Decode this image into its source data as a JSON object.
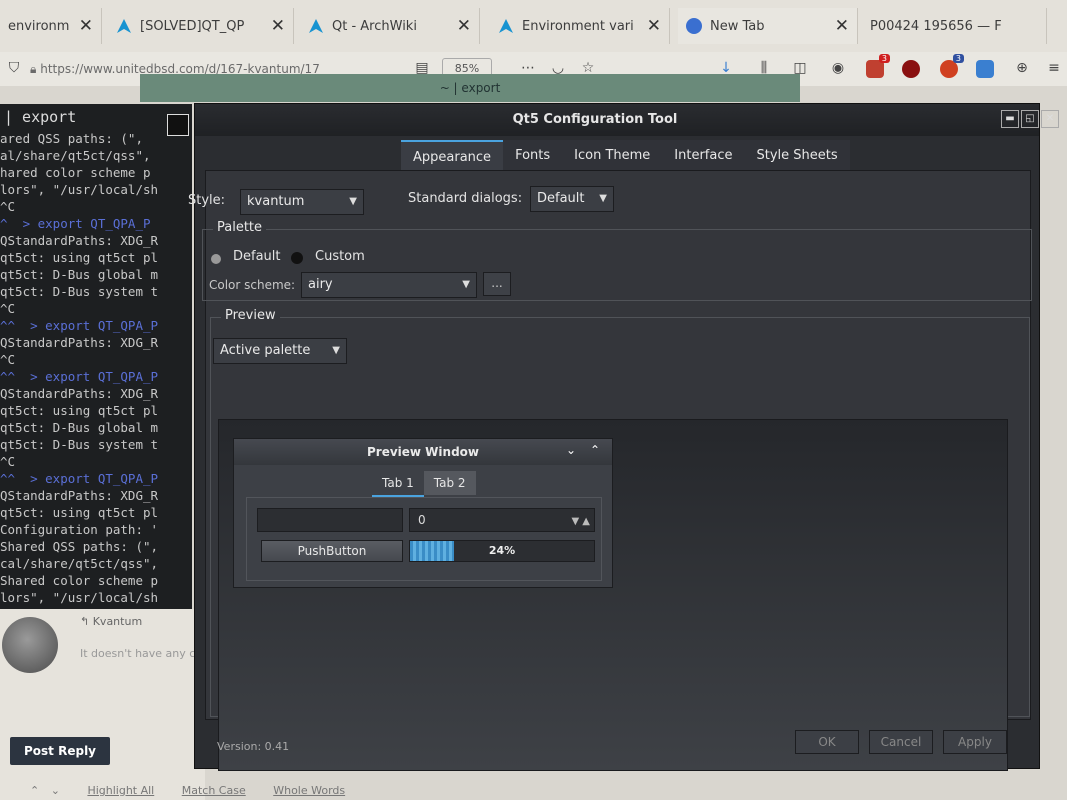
{
  "browser": {
    "tabs": [
      {
        "label": "environm"
      },
      {
        "label": "[SOLVED]QT_QP"
      },
      {
        "label": "Qt - ArchWiki"
      },
      {
        "label": "Environment vari"
      },
      {
        "label": "New Tab"
      },
      {
        "label": "P00424 195656 — F"
      }
    ],
    "url": "https://www.unitedbsd.com/d/167-kvantum/17",
    "zoom": "85%",
    "ext_badges": [
      "3",
      "3"
    ]
  },
  "terminal": {
    "window_title": "~ | export",
    "title": "| export",
    "lines": [
      {
        "t": "ared QSS paths: (\",",
        "c": ""
      },
      {
        "t": "al/share/qt5ct/qss\",",
        "c": ""
      },
      {
        "t": "hared color scheme p",
        "c": ""
      },
      {
        "t": "lors\", \"/usr/local/sh",
        "c": ""
      },
      {
        "t": "^C",
        "c": ""
      },
      {
        "t": "^  > export QT_QPA_P",
        "c": "b"
      },
      {
        "t": "QStandardPaths: XDG_R",
        "c": ""
      },
      {
        "t": "qt5ct: using qt5ct pl",
        "c": ""
      },
      {
        "t": "qt5ct: D-Bus global m",
        "c": ""
      },
      {
        "t": "qt5ct: D-Bus system t",
        "c": ""
      },
      {
        "t": "^C",
        "c": ""
      },
      {
        "t": "^^  > export QT_QPA_P",
        "c": "b"
      },
      {
        "t": "QStandardPaths: XDG_R",
        "c": ""
      },
      {
        "t": "^C",
        "c": ""
      },
      {
        "t": "^^  > export QT_QPA_P",
        "c": "b"
      },
      {
        "t": "QStandardPaths: XDG_R",
        "c": ""
      },
      {
        "t": "qt5ct: using qt5ct pl",
        "c": ""
      },
      {
        "t": "qt5ct: D-Bus global m",
        "c": ""
      },
      {
        "t": "qt5ct: D-Bus system t",
        "c": ""
      },
      {
        "t": "^C",
        "c": ""
      },
      {
        "t": "^^  > export QT_QPA_P",
        "c": "b"
      },
      {
        "t": "QStandardPaths: XDG_R",
        "c": ""
      },
      {
        "t": "qt5ct: using qt5ct pl",
        "c": ""
      },
      {
        "t": "Configuration path: '",
        "c": ""
      },
      {
        "t": "Shared QSS paths: (\",",
        "c": ""
      },
      {
        "t": "cal/share/qt5ct/qss\",",
        "c": ""
      },
      {
        "t": "Shared color scheme p",
        "c": ""
      },
      {
        "t": "lors\", \"/usr/local/sh",
        "c": ""
      }
    ]
  },
  "forum": {
    "reply_name": "Kvantum",
    "reply_text": "It doesn't have any c",
    "post_reply": "Post Reply",
    "find": [
      "Highlight All",
      "Match Case",
      "Whole Words"
    ]
  },
  "qt": {
    "title": "Qt5 Configuration Tool",
    "tabs": [
      "Appearance",
      "Fonts",
      "Icon Theme",
      "Interface",
      "Style Sheets"
    ],
    "style_label": "Style:",
    "style_value": "kvantum",
    "dialogs_label": "Standard dialogs:",
    "dialogs_value": "Default",
    "palette": {
      "title": "Palette",
      "default_label": "Default",
      "custom_label": "Custom",
      "scheme_label": "Color scheme:",
      "scheme_value": "airy",
      "more_label": "..."
    },
    "preview": {
      "title": "Preview",
      "palette_value": "Active palette",
      "window_title": "Preview Window",
      "tabs": [
        "Tab 1",
        "Tab 2"
      ],
      "spin_value": "0",
      "button_label": "PushButton",
      "progress_text": "24%",
      "progress_fraction": 0.24
    },
    "version": "Version: 0.41",
    "buttons": {
      "ok": "OK",
      "cancel": "Cancel",
      "apply": "Apply"
    }
  }
}
